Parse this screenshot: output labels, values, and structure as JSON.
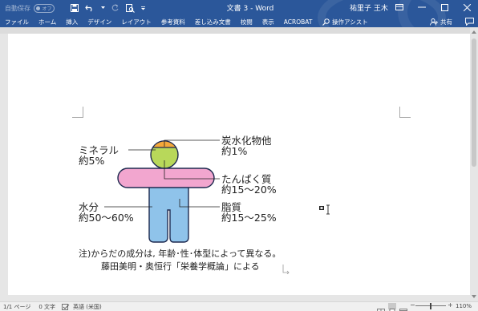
{
  "window": {
    "autosave_label": "自動保存",
    "autosave_state": "オフ",
    "doc_title": "文書 3  -  Word",
    "user_name": "祐里子 王木"
  },
  "tabs": [
    "ファイル",
    "ホーム",
    "挿入",
    "デザイン",
    "レイアウト",
    "参考資料",
    "差し込み文書",
    "校閲",
    "表示",
    "ACROBAT"
  ],
  "tell_me": "操作アシスト",
  "share_label": "共有",
  "figure": {
    "labels": {
      "mineral_name": "ミネラル",
      "mineral_pct": "約5%",
      "carb_name": "炭水化物他",
      "carb_pct": "約1%",
      "protein_name": "たんぱく質",
      "protein_pct": "約15～20%",
      "water_name": "水分",
      "water_pct": "約50～60%",
      "fat_name": "脂質",
      "fat_pct": "約15～25%"
    },
    "note_line1": "注)からだの成分は, 年齢･性･体型によって異なる。",
    "note_line2": "藤田美明・奥恒行「栄養学概論」による"
  },
  "colors": {
    "title_bar": "#2b579a",
    "head_orange": "#f4a83a",
    "head_green": "#b8d85a",
    "arms_pink": "#f2a6cf",
    "body_blue": "#8fc3ea"
  },
  "statusbar": {
    "page": "1/1 ページ",
    "words": "0 文字",
    "language": "英語 (米国)",
    "zoom": "110%"
  }
}
